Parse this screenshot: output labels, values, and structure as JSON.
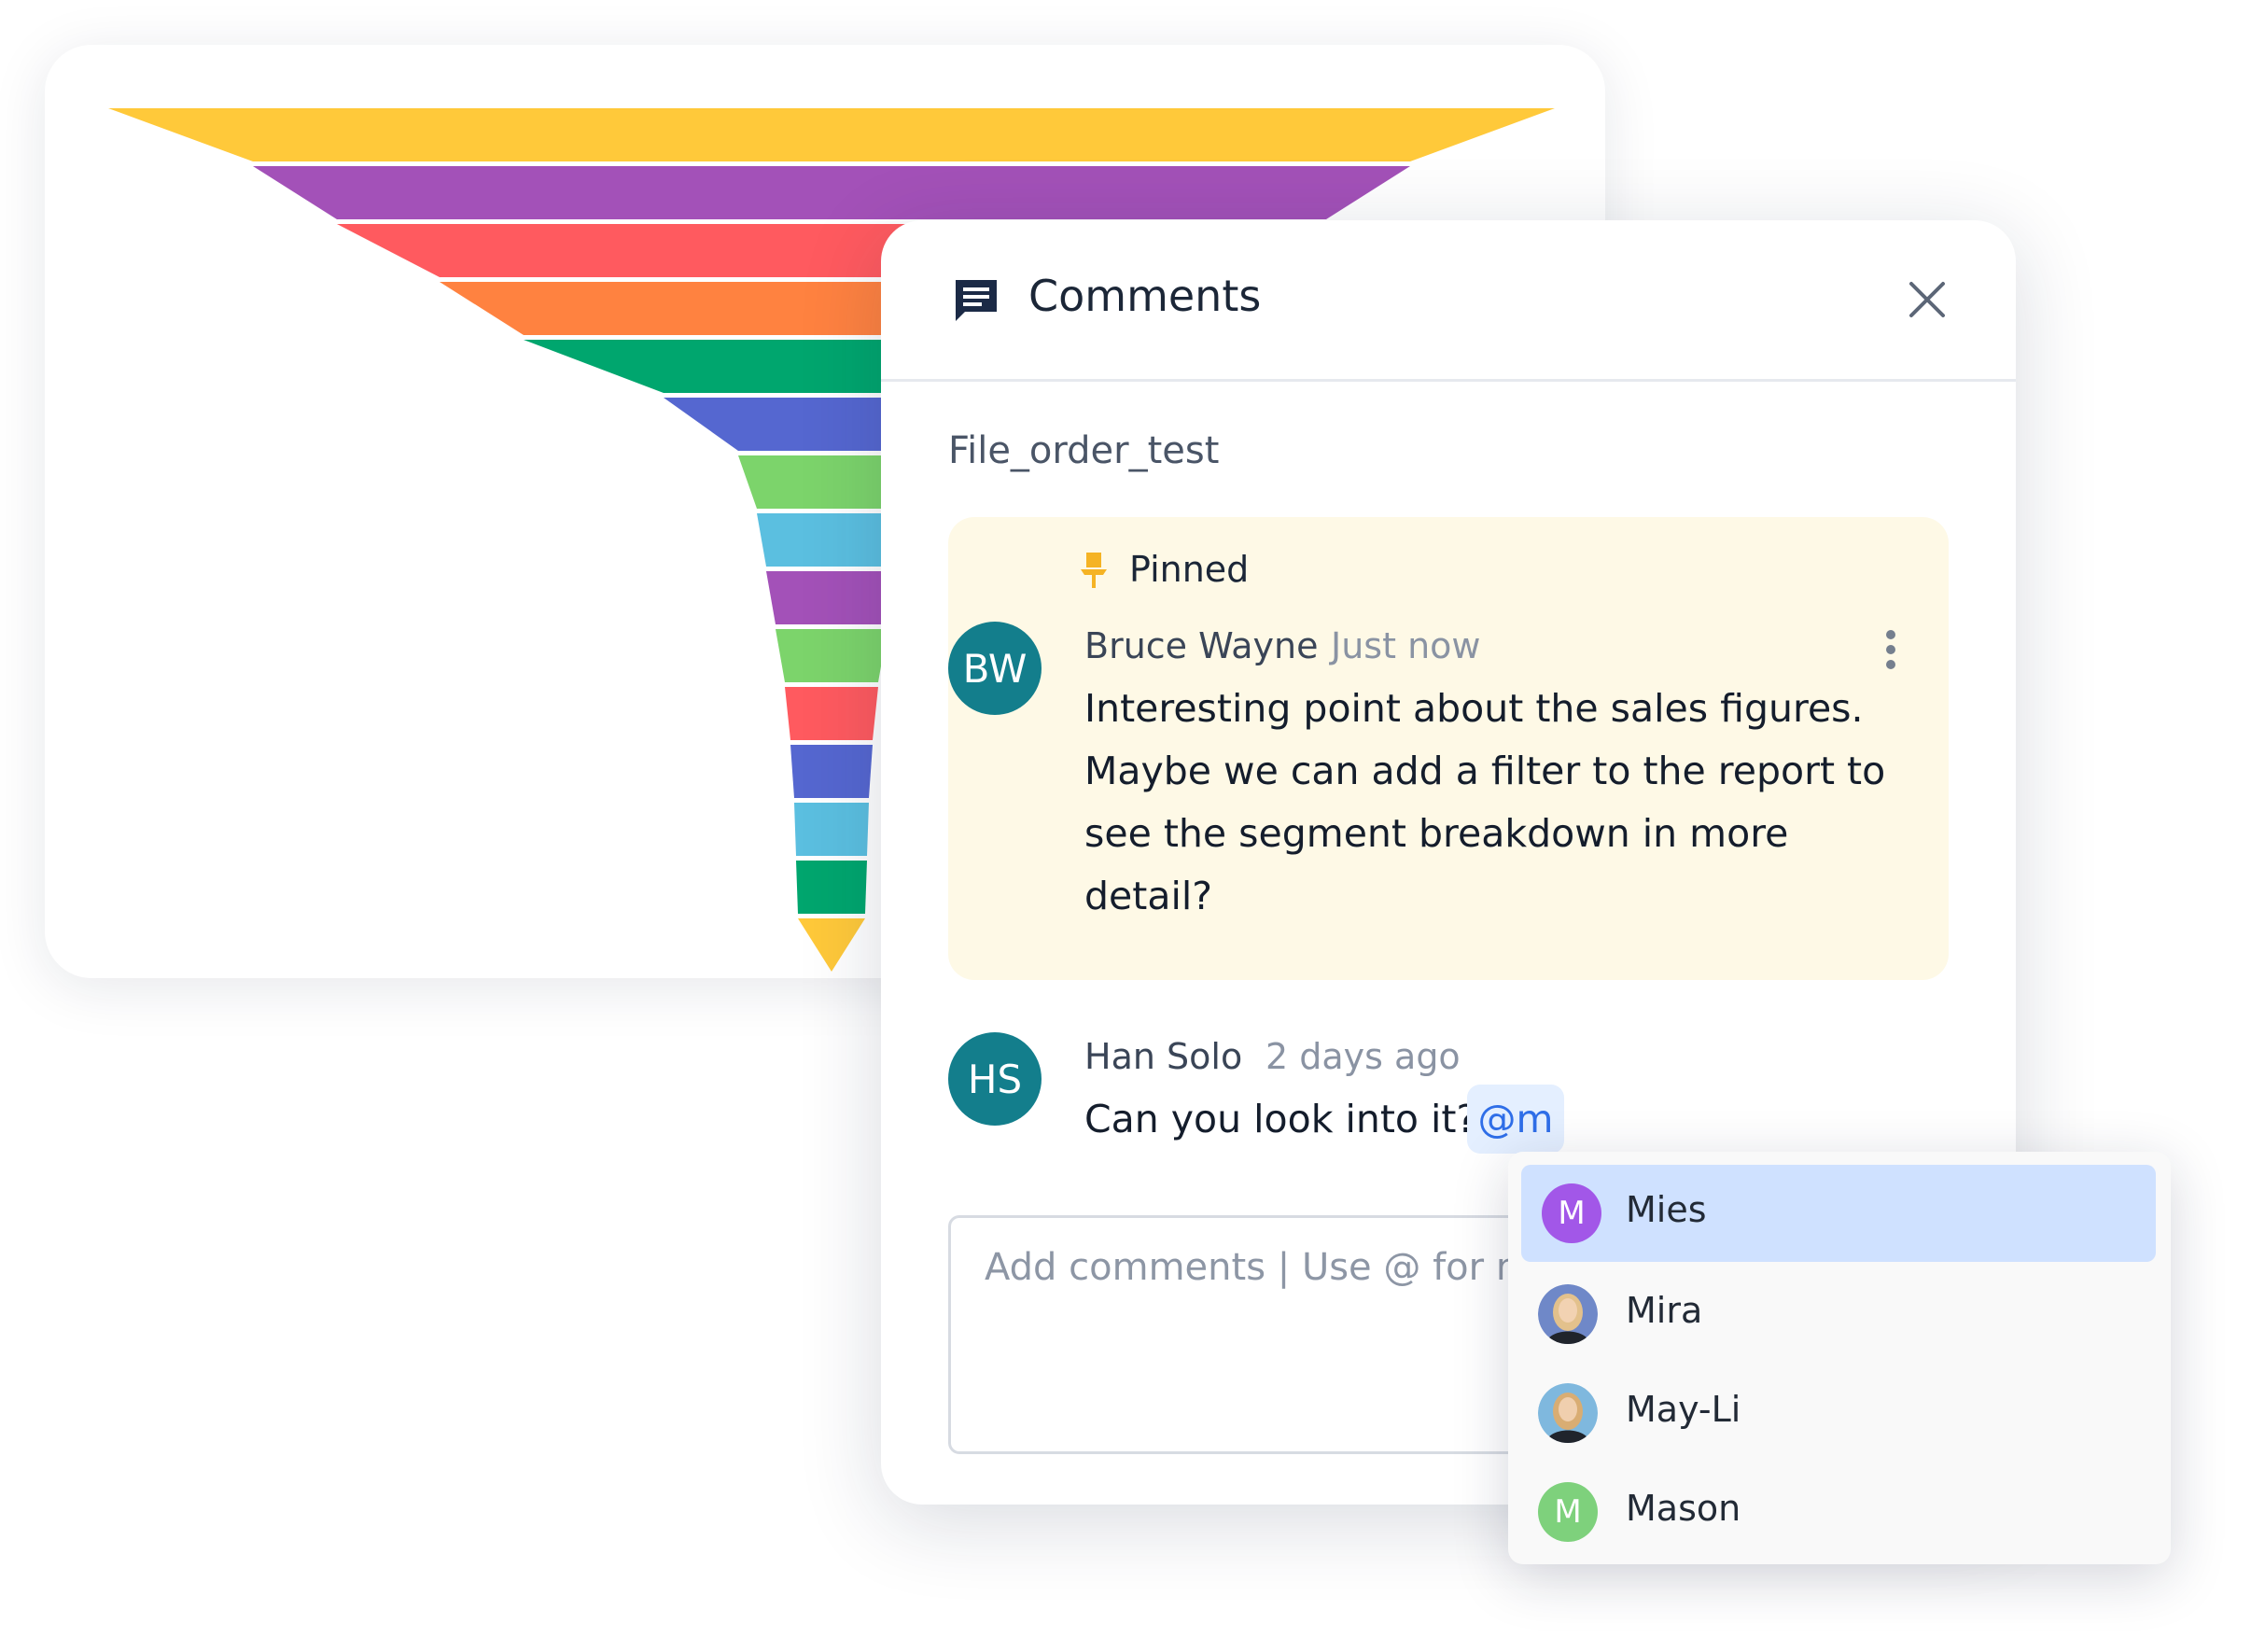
{
  "chart_data": {
    "type": "funnel",
    "series": [
      {
        "color": "#FFC93A"
      },
      {
        "color": "#A351B8"
      },
      {
        "color": "#FF5A5F"
      },
      {
        "color": "#FF8240"
      },
      {
        "color": "#00A66E"
      },
      {
        "color": "#5567D0"
      },
      {
        "color": "#7CD46B"
      },
      {
        "color": "#5BBFE0"
      },
      {
        "color": "#A351B8"
      },
      {
        "color": "#7CD46B"
      },
      {
        "color": "#FF5A5F"
      },
      {
        "color": "#5567D0"
      },
      {
        "color": "#5BBFE0"
      },
      {
        "color": "#00A66E"
      },
      {
        "color": "#FFC93A"
      }
    ]
  },
  "panel": {
    "title": "Comments",
    "icon": "comments-icon",
    "close_icon": "close-icon",
    "file_name": "File_order_test"
  },
  "pinned_comment": {
    "pinned_label": "Pinned",
    "avatar_initials": "BW",
    "avatar_color": "#137E8C",
    "author": "Bruce Wayne",
    "time": "Just now",
    "text_lines": [
      "Interesting point about the sales figures.",
      "Maybe we can add a filter to the report to",
      "see the segment breakdown in more",
      "detail?"
    ]
  },
  "comment": {
    "avatar_initials": "HS",
    "avatar_color": "#137E8C",
    "author": "Han Solo",
    "time": "2 days ago",
    "text": "Can you look into it?",
    "mention": "@m"
  },
  "input": {
    "placeholder": "Add comments | Use @ for n"
  },
  "mention_dropdown": {
    "items": [
      {
        "name": "Mies",
        "initial": "M",
        "avatar_color": "#A257E8",
        "selected": true
      },
      {
        "name": "Mira",
        "initial": "",
        "avatar": "photo"
      },
      {
        "name": "May-Li",
        "initial": "",
        "avatar": "photo"
      },
      {
        "name": "Mason",
        "initial": "M",
        "avatar_color": "#7ED17C"
      }
    ]
  }
}
